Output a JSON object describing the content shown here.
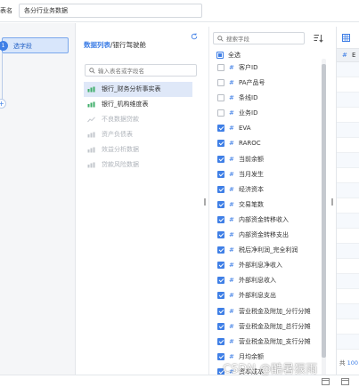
{
  "topbar": {
    "label": "表名",
    "table_name_value": "各分行业务数据"
  },
  "steps": {
    "number": "1",
    "label": "选字段",
    "add": "+"
  },
  "db_panel": {
    "title_accent": "数据列表",
    "title_rest": "/银行驾驶舱",
    "search_placeholder": "输入表名或字段名",
    "items": [
      {
        "label": "银行_财务分析事实表",
        "state": "selected"
      },
      {
        "label": "银行_机构维度表",
        "state": "normal"
      },
      {
        "label": "不良数据贷款",
        "state": "disabled"
      },
      {
        "label": "资产负债表",
        "state": "disabled"
      },
      {
        "label": "效益分析数据",
        "state": "disabled"
      },
      {
        "label": "贷款风险数据",
        "state": "disabled"
      }
    ]
  },
  "fields_panel": {
    "search_placeholder": "搜索字段",
    "select_all_label": "全选",
    "fields": [
      {
        "name": "客户ID",
        "checked": false
      },
      {
        "name": "PA产品号",
        "checked": false
      },
      {
        "name": "条线ID",
        "checked": false
      },
      {
        "name": "业务ID",
        "checked": false
      },
      {
        "name": "EVA",
        "checked": true
      },
      {
        "name": "RAROC",
        "checked": true
      },
      {
        "name": "当前余额",
        "checked": true
      },
      {
        "name": "当月发生",
        "checked": true
      },
      {
        "name": "经济资本",
        "checked": true
      },
      {
        "name": "交易笔数",
        "checked": true
      },
      {
        "name": "内部资金转移收入",
        "checked": true
      },
      {
        "name": "内部资金转移支出",
        "checked": true
      },
      {
        "name": "税后净利润_完全利润",
        "checked": true
      },
      {
        "name": "外部利息净收入",
        "checked": true
      },
      {
        "name": "外部利息收入",
        "checked": true
      },
      {
        "name": "外部利息支出",
        "checked": true
      },
      {
        "name": "营业税金及附加_分行分摊",
        "checked": true
      },
      {
        "name": "营业税金及附加_总行分摊",
        "checked": true
      },
      {
        "name": "营业税金及附加_支行分摊",
        "checked": true
      },
      {
        "name": "月均余额",
        "checked": true
      },
      {
        "name": "资本成本",
        "checked": true
      }
    ]
  },
  "preview_panel": {
    "column_header": "E",
    "footer_prefix": "共",
    "footer_count": "100"
  },
  "watermark": "CSDN @酷暑狠雨",
  "colors": {
    "accent": "#3f7fe6",
    "selected_bg": "#dfe8f8",
    "disabled_text": "#aeb3ba"
  }
}
